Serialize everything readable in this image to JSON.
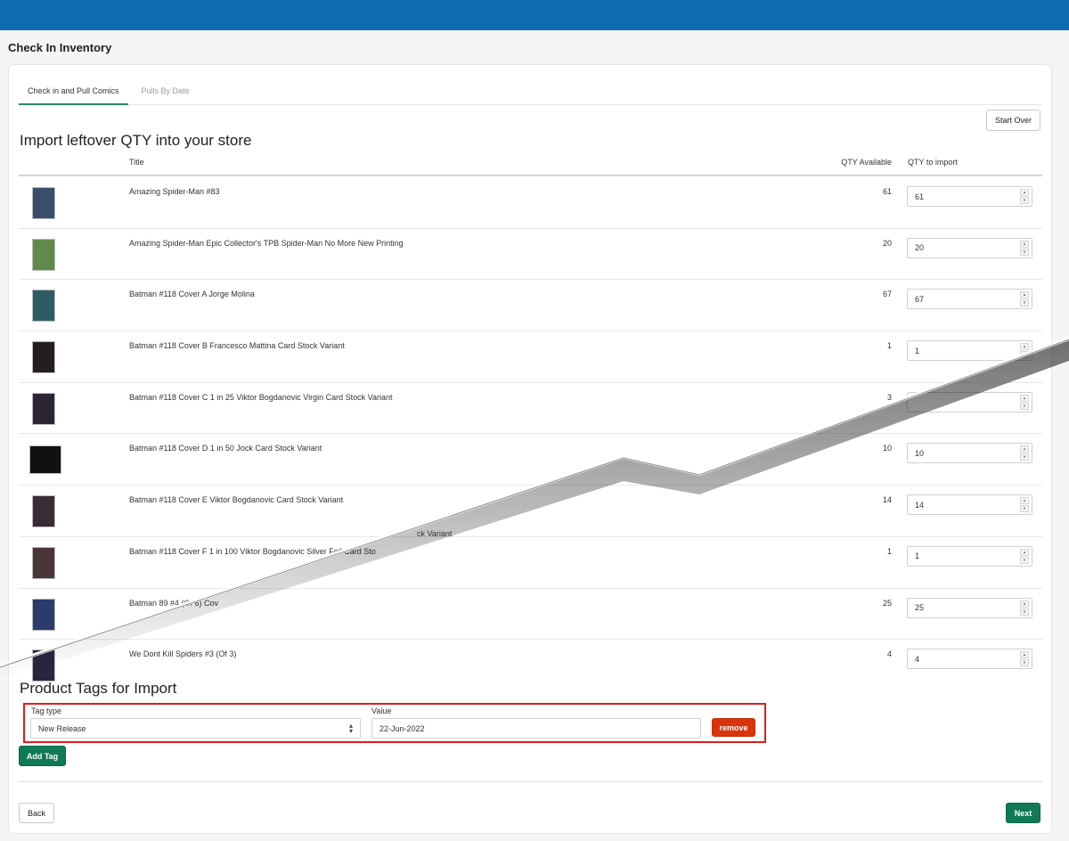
{
  "page": {
    "title": "Check In Inventory"
  },
  "tabs": [
    {
      "label": "Check in and Pull Comics",
      "active": true
    },
    {
      "label": "Pulls By Date",
      "active": false
    }
  ],
  "start_over_label": "Start Over",
  "import_section": {
    "title": "Import leftover QTY into your store",
    "columns": {
      "title": "Title",
      "qty_available": "QTY Available",
      "qty_to_import": "QTY to import"
    },
    "rows": [
      {
        "title": "Amazing Spider-Man #83",
        "available": "61",
        "import_qty": "61",
        "cover_color": "#3a4e6b"
      },
      {
        "title": "Amazing Spider-Man Epic Collector's TPB Spider-Man No More New Printing",
        "available": "20",
        "import_qty": "20",
        "cover_color": "#5f8a4a"
      },
      {
        "title": "Batman #118 Cover A Jorge Molina",
        "available": "67",
        "import_qty": "67",
        "cover_color": "#2d5b66"
      },
      {
        "title": "Batman #118 Cover B Francesco Mattina Card Stock Variant",
        "available": "1",
        "import_qty": "1",
        "cover_color": "#241d22"
      },
      {
        "title": "Batman #118 Cover C 1 in 25 Viktor Bogdanovic Virgin Card Stock Variant",
        "available": "3",
        "import_qty": "",
        "cover_color": "#2b2433"
      },
      {
        "title": "Batman #118 Cover D 1 in 50 Jock Card Stock Variant",
        "available": "10",
        "import_qty": "10",
        "cover_color": "#111111"
      },
      {
        "title": "Batman #118 Cover E Viktor Bogdanovic Card Stock Variant",
        "available": "14",
        "import_qty": "14",
        "cover_color": "#3a2b35"
      },
      {
        "title": "Batman #118 Cover F 1 in 100 Viktor Bogdanovic Silver Foil Card Sto",
        "available": "1",
        "import_qty": "1",
        "cover_color": "#4a3538"
      },
      {
        "title": "Batman 89 #4 (Of 6) Cov",
        "available": "25",
        "import_qty": "25",
        "cover_color": "#2b3b6a"
      },
      {
        "title": "We Dont Kill Spiders #3 (Of 3)",
        "available": "4",
        "import_qty": "4",
        "cover_color": "#2a2440"
      }
    ],
    "torn_fragment_text": "ck Variant"
  },
  "tags_section": {
    "title": "Product Tags for Import",
    "tag_type_label": "Tag type",
    "tag_type_value": "New Release",
    "value_label": "Value",
    "value": "22-Jun-2022",
    "remove_label": "remove",
    "add_tag_label": "Add Tag"
  },
  "footer": {
    "back_label": "Back",
    "next_label": "Next"
  },
  "colors": {
    "topbar": "#0f6cb2",
    "primary": "#107a55",
    "danger": "#d9340c",
    "highlight_border": "#e01b1b"
  }
}
